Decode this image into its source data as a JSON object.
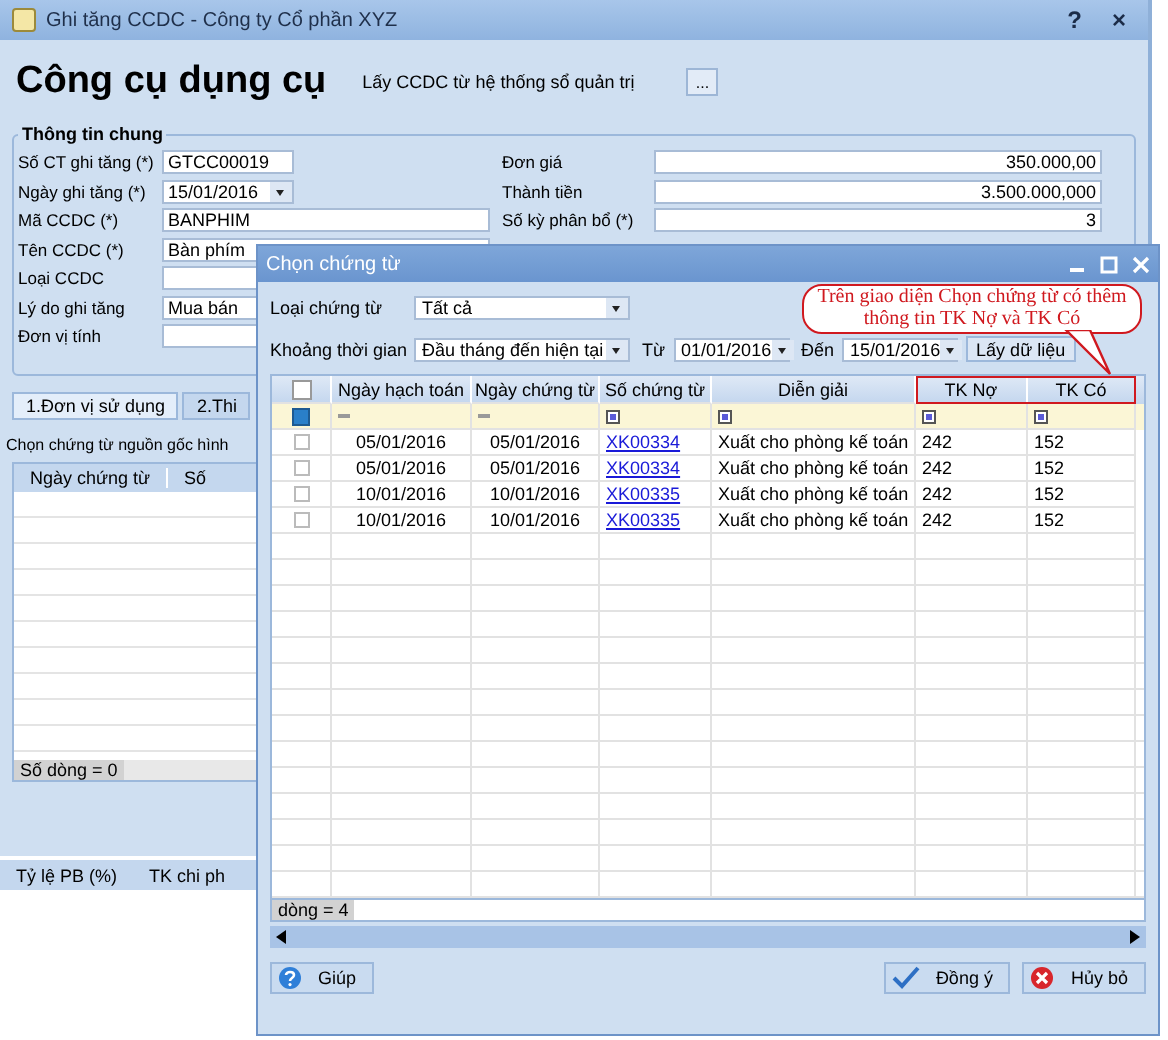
{
  "window": {
    "title": "Ghi tăng CCDC - Công ty Cổ phần XYZ",
    "help": "?",
    "close": "×"
  },
  "header": {
    "title": "Công cụ dụng cụ",
    "source_label": "Lấy CCDC từ hệ thống sổ quản trị",
    "source_button": "..."
  },
  "general_info": {
    "legend": "Thông tin chung",
    "left_fields": [
      {
        "label": "Số CT ghi tăng (*)",
        "value": "GTCC00019",
        "kind": "text"
      },
      {
        "label": "Ngày ghi tăng (*)",
        "value": "15/01/2016",
        "kind": "date"
      },
      {
        "label": "Mã CCDC (*)",
        "value": "BANPHIM",
        "kind": "wide"
      },
      {
        "label": "Tên CCDC (*)",
        "value": "Bàn phím",
        "kind": "wide"
      },
      {
        "label": "Loại CCDC",
        "kind": "wide"
      },
      {
        "label": "Lý do ghi tăng",
        "value": "Mua bán",
        "kind": "wide"
      },
      {
        "label": "Đơn vị tính",
        "kind": "wide"
      }
    ],
    "right_fields": [
      {
        "label": "Đơn giá",
        "value": "350.000,00"
      },
      {
        "label": "Thành tiền",
        "value": "3.500.000,000"
      },
      {
        "label": "Số kỳ phân bổ (*)",
        "value": "3"
      }
    ]
  },
  "tabs": [
    {
      "label": "1.Đơn vị sử dụng",
      "selected": true
    },
    {
      "label": "2.Thi",
      "selected": false
    }
  ],
  "source_caption": "Chọn chứng từ nguồn gốc hình",
  "source_grid": {
    "columns": [
      "Ngày chứng từ",
      "Số"
    ],
    "footer": "Số dòng = 0"
  },
  "bottom_strip": {
    "columns": [
      "Tỷ lệ PB (%)",
      "TK chi ph"
    ]
  },
  "dialog": {
    "title": "Chọn chứng từ",
    "filters": {
      "type_label": "Loại chứng từ",
      "type_value": "Tất cả",
      "period_label": "Khoảng thời gian",
      "period_value": "Đầu tháng đến hiện tại",
      "from_label": "Từ",
      "from_value": "01/01/2016",
      "to_label": "Đến",
      "to_value": "15/01/2016",
      "fetch_button": "Lấy dữ liệu"
    },
    "grid": {
      "select_all_checked": false,
      "columns": [
        "Ngày hạch toán",
        "Ngày chứng từ",
        "Số chứng từ",
        "Diễn giải",
        "TK Nợ",
        "TK Có"
      ],
      "rows": [
        {
          "checked": false,
          "posting_date": "05/01/2016",
          "doc_date": "05/01/2016",
          "doc_no": "XK00334",
          "description": "Xuất cho phòng kế toán",
          "debit": "242",
          "credit": "152"
        },
        {
          "checked": false,
          "posting_date": "05/01/2016",
          "doc_date": "05/01/2016",
          "doc_no": "XK00334",
          "description": "Xuất cho phòng kế toán",
          "debit": "242",
          "credit": "152"
        },
        {
          "checked": false,
          "posting_date": "10/01/2016",
          "doc_date": "10/01/2016",
          "doc_no": "XK00335",
          "description": "Xuất cho phòng kế toán",
          "debit": "242",
          "credit": "152"
        },
        {
          "checked": false,
          "posting_date": "10/01/2016",
          "doc_date": "10/01/2016",
          "doc_no": "XK00335",
          "description": "Xuất cho phòng kế toán",
          "debit": "242",
          "credit": "152"
        }
      ],
      "footer": "dòng = 4"
    },
    "buttons": [
      {
        "label": "Giúp",
        "kind": "help"
      },
      {
        "label": "Đồng ý",
        "kind": "ok"
      },
      {
        "label": "Hủy bỏ",
        "kind": "cancel"
      }
    ],
    "callout": "Trên giao diện Chọn chứng từ có thêm thông tin TK Nợ và TK Có"
  }
}
